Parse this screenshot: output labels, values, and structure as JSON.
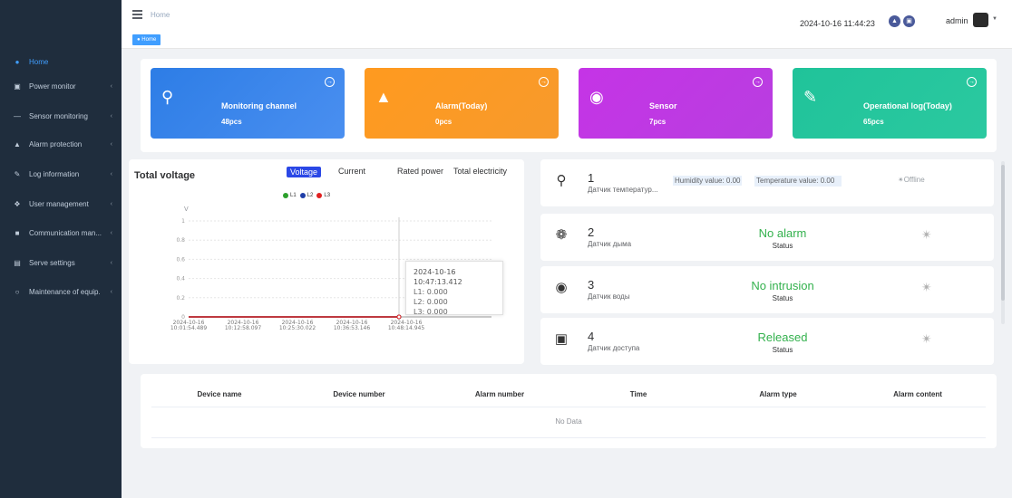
{
  "sidebar": {
    "items": [
      {
        "label": "Home",
        "icon": "home-icon"
      },
      {
        "label": "Power monitor",
        "icon": "monitor-icon"
      },
      {
        "label": "Sensor monitoring",
        "icon": "sensor-icon"
      },
      {
        "label": "Alarm protection",
        "icon": "alarm-icon"
      },
      {
        "label": "Log information",
        "icon": "log-icon"
      },
      {
        "label": "User management",
        "icon": "user-icon"
      },
      {
        "label": "Communication man...",
        "icon": "chat-icon"
      },
      {
        "label": "Serve settings",
        "icon": "server-icon"
      },
      {
        "label": "Maintenance of equip.",
        "icon": "maintenance-icon"
      }
    ]
  },
  "header": {
    "breadcrumb": "Home",
    "datetime": "2024-10-16 11:44:23",
    "user": "admin",
    "tag": "Home"
  },
  "stats": [
    {
      "title": "Monitoring channel",
      "value": "48pcs",
      "color": "#3a7be6"
    },
    {
      "title": "Alarm(Today)",
      "value": "0pcs",
      "color": "#f7901e"
    },
    {
      "title": "Sensor",
      "value": "7pcs",
      "color": "#c135e3"
    },
    {
      "title": "Operational log(Today)",
      "value": "65pcs",
      "color": "#22c39b"
    }
  ],
  "voltage": {
    "title": "Total voltage",
    "tabs": [
      "Voltage",
      "Current",
      "Rated power",
      "Total electricity"
    ],
    "unit": "V",
    "legend": [
      "L1",
      "L2",
      "L3"
    ],
    "tooltip": {
      "time": "2024-10-16 10:47:13.412",
      "l1": "L1: 0.000",
      "l2": "L2: 0.000",
      "l3": "L3: 0.000"
    }
  },
  "chart_data": {
    "type": "line",
    "title": "",
    "ylabel": "V",
    "ylim": [
      0,
      1
    ],
    "y_ticks": [
      "0",
      "0.2",
      "0.4",
      "0.6",
      "0.8",
      "1"
    ],
    "x_ticks": [
      [
        "2024-10-16",
        "10:01:54.489"
      ],
      [
        "2024-10-16",
        "10:12:58.097"
      ],
      [
        "2024-10-16",
        "10:25:30.022"
      ],
      [
        "2024-10-16",
        "10:36:53.146"
      ],
      [
        "2024-10-16",
        "10:48:14.945"
      ]
    ],
    "series": [
      {
        "name": "L1",
        "color": "#2ca02c",
        "values": [
          0,
          0,
          0,
          0,
          0,
          0
        ]
      },
      {
        "name": "L2",
        "color": "#1f3ea8",
        "values": [
          0,
          0,
          0,
          0,
          0,
          0
        ]
      },
      {
        "name": "L3",
        "color": "#e02020",
        "values": [
          0,
          0,
          0,
          0,
          0,
          0
        ]
      }
    ],
    "grid": true
  },
  "sensors": [
    {
      "num": "1",
      "name": "Датчик температур...",
      "humidity": "Humidity value: 0.00",
      "temperature": "Temperature value: 0.00",
      "connection": "Offline",
      "icon": "thermometer-icon"
    },
    {
      "num": "2",
      "name": "Датчик дыма",
      "status": "No alarm",
      "status_label": "Status",
      "icon": "smoke-icon"
    },
    {
      "num": "3",
      "name": "Датчик воды",
      "status": "No intrusion",
      "status_label": "Status",
      "icon": "water-icon"
    },
    {
      "num": "4",
      "name": "Датчик доступа",
      "status": "Released",
      "status_label": "Status",
      "icon": "lock-icon"
    }
  ],
  "alarm_table": {
    "headers": [
      "Device name",
      "Device number",
      "Alarm number",
      "Time",
      "Alarm type",
      "Alarm content"
    ],
    "empty": "No Data"
  }
}
